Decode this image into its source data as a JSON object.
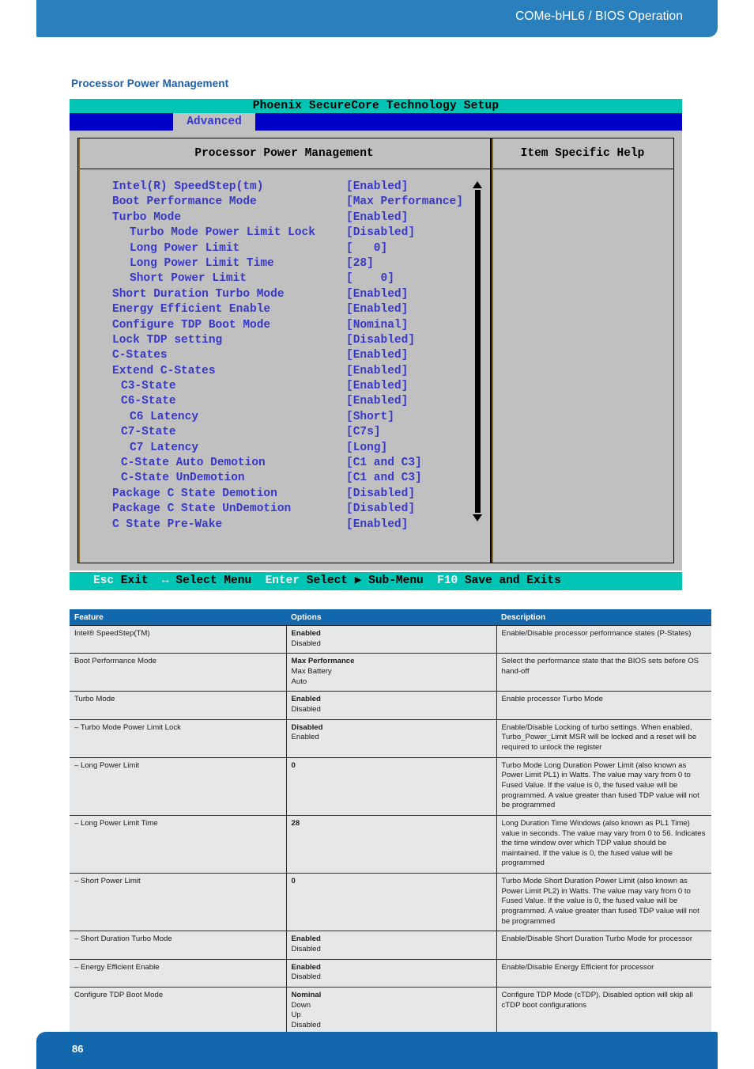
{
  "header": {
    "title": "COMe-bHL6 / BIOS Operation"
  },
  "section": {
    "heading": "Processor Power Management"
  },
  "bios": {
    "title": "Phoenix SecureCore Technology Setup",
    "active_tab": "Advanced",
    "panel_title": "Processor Power Management",
    "help_title": "Item Specific Help",
    "items": [
      {
        "label": "Intel(R) SpeedStep(tm)",
        "value": "[Enabled]",
        "indent": 0
      },
      {
        "label": "Boot Performance Mode",
        "value": "[Max Performance]",
        "indent": 0
      },
      {
        "label": "Turbo Mode",
        "value": "[Enabled]",
        "indent": 0
      },
      {
        "label": "Turbo Mode Power Limit Lock",
        "value": "[Disabled]",
        "indent": 2
      },
      {
        "label": "Long Power Limit",
        "value": "[   0]",
        "indent": 2
      },
      {
        "label": "Long Power Limit Time",
        "value": "[28]",
        "indent": 2
      },
      {
        "label": "Short Power Limit",
        "value": "[    0]",
        "indent": 2
      },
      {
        "label": "Short Duration Turbo Mode",
        "value": "[Enabled]",
        "indent": 0
      },
      {
        "label": "Energy Efficient Enable",
        "value": "[Enabled]",
        "indent": 0
      },
      {
        "label": "Configure TDP Boot Mode",
        "value": "[Nominal]",
        "indent": 0
      },
      {
        "label": "Lock TDP setting",
        "value": "[Disabled]",
        "indent": 0
      },
      {
        "label": "C-States",
        "value": "[Enabled]",
        "indent": 0
      },
      {
        "label": "Extend C-States",
        "value": "[Enabled]",
        "indent": 0
      },
      {
        "label": "C3-State",
        "value": "[Enabled]",
        "indent": 1
      },
      {
        "label": "C6-State",
        "value": "[Enabled]",
        "indent": 1
      },
      {
        "label": "C6 Latency",
        "value": "[Short]",
        "indent": 2
      },
      {
        "label": "C7-State",
        "value": "[C7s]",
        "indent": 1
      },
      {
        "label": "C7 Latency",
        "value": "[Long]",
        "indent": 2
      },
      {
        "label": "C-State Auto Demotion",
        "value": "[C1 and C3]",
        "indent": 1
      },
      {
        "label": "C-State UnDemotion",
        "value": "[C1 and C3]",
        "indent": 1
      },
      {
        "label": "Package C State Demotion",
        "value": "[Disabled]",
        "indent": 0
      },
      {
        "label": "Package C State UnDemotion",
        "value": "[Disabled]",
        "indent": 0
      },
      {
        "label": "C State Pre-Wake",
        "value": "[Enabled]",
        "indent": 0
      }
    ],
    "scrollbar": {
      "up_arrow": "▲",
      "down_arrow": "▼"
    },
    "status_keys": [
      {
        "key": "Esc",
        "text": " Exit"
      },
      {
        "key": "↔",
        "text": " Select Menu"
      },
      {
        "key": "Enter",
        "text": " Select ▶ Sub-Menu"
      },
      {
        "key": "F10",
        "text": " Save and Exits"
      }
    ]
  },
  "table": {
    "columns": [
      "Feature",
      "Options",
      "Description"
    ],
    "rows": [
      {
        "feature": "Intel® SpeedStep(TM)",
        "default": "Enabled",
        "options": [
          "Disabled"
        ],
        "description": "Enable/Disable processor performance states (P-States)"
      },
      {
        "feature": "Boot Performance Mode",
        "default": "Max Performance",
        "options": [
          "Max Battery",
          "Auto"
        ],
        "description": "Select the performance state that the BIOS sets before OS hand-off"
      },
      {
        "feature": "Turbo Mode",
        "default": "Enabled",
        "options": [
          "Disabled"
        ],
        "description": "Enable processor Turbo Mode"
      },
      {
        "feature": "– Turbo Mode Power Limit Lock",
        "default": "Disabled",
        "options": [
          "Enabled"
        ],
        "description": "Enable/Disable Locking of turbo settings. When enabled, Turbo_Power_Limit MSR will be locked and a reset will be required to unlock the register"
      },
      {
        "feature": "– Long Power Limit",
        "default": "0",
        "options": [],
        "description": "Turbo Mode Long Duration Power Limit (also known as Power Limit PL1) in Watts. The value may vary from 0 to Fused Value. If the value is 0, the fused value will be programmed. A value greater than fused TDP value will not be programmed"
      },
      {
        "feature": "– Long Power Limit Time",
        "default": "28",
        "options": [],
        "description": "Long Duration Time Windows (also known as PL1 Time) value in seconds. The value may vary from 0 to 56. Indicates the time window over which TDP value should be maintained. If the value is 0, the fused value will be programmed"
      },
      {
        "feature": "– Short Power Limit",
        "default": "0",
        "options": [],
        "description": "Turbo Mode Short Duration Power Limit (also known as Power Limit PL2) in Watts. The value may vary from 0 to Fused Value. If the value is 0, the fused value will be programmed. A value greater than fused TDP value will not be programmed"
      },
      {
        "feature": "– Short Duration Turbo Mode",
        "default": "Enabled",
        "options": [
          "Disabled"
        ],
        "description": "Enable/Disable Short Duration Turbo Mode for processor"
      },
      {
        "feature": "– Energy Efficient Enable",
        "default": "Enabled",
        "options": [
          "Disabled"
        ],
        "description": "Enable/Disable Energy Efficient for processor"
      },
      {
        "feature": "Configure TDP Boot Mode",
        "default": "Nominal",
        "options": [
          "Down",
          "Up",
          "Disabled"
        ],
        "description": "Configure TDP Mode (cTDP). Disabled option will skip all cTDP boot configurations"
      }
    ]
  },
  "footer": {
    "page_number": "86"
  },
  "colors": {
    "header_blue": "#2980bd",
    "footer_blue": "#1368ad",
    "table_header_blue": "#1368ad",
    "heading_blue": "#1c5ea8",
    "bios_teal": "#00c4b4",
    "bios_menu_blue": "#0000c8",
    "bios_gray": "#c0c0c0",
    "bios_text_blue": "#3838c8",
    "row_gray": "#e6e7e8"
  }
}
